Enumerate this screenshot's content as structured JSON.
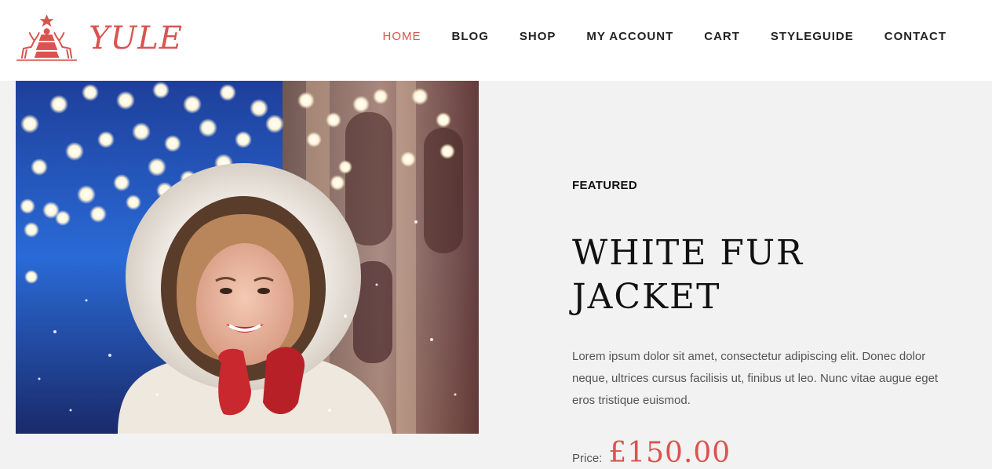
{
  "brand": {
    "name": "YULE",
    "color": "#d9534f"
  },
  "nav": {
    "items": [
      {
        "label": "HOME",
        "active": true
      },
      {
        "label": "BLOG",
        "active": false
      },
      {
        "label": "SHOP",
        "active": false
      },
      {
        "label": "MY ACCOUNT",
        "active": false
      },
      {
        "label": "CART",
        "active": false
      },
      {
        "label": "STYLEGUIDE",
        "active": false
      },
      {
        "label": "CONTACT",
        "active": false
      }
    ]
  },
  "hero": {
    "image_icon": "woman-in-white-fur-hood-photo"
  },
  "product": {
    "eyebrow": "FEATURED",
    "title": "WHITE FUR JACKET",
    "description": "Lorem ipsum dolor sit amet, consectetur adipiscing elit. Donec dolor neque, ultrices cursus facilisis ut, finibus ut leo. Nunc vitae augue eget eros tristique euismod.",
    "price_label": "Price:",
    "price": "£150.00"
  },
  "colors": {
    "accent": "#d9534f",
    "page_bg": "#f2f2f2",
    "header_bg": "#ffffff",
    "text": "#111111"
  }
}
